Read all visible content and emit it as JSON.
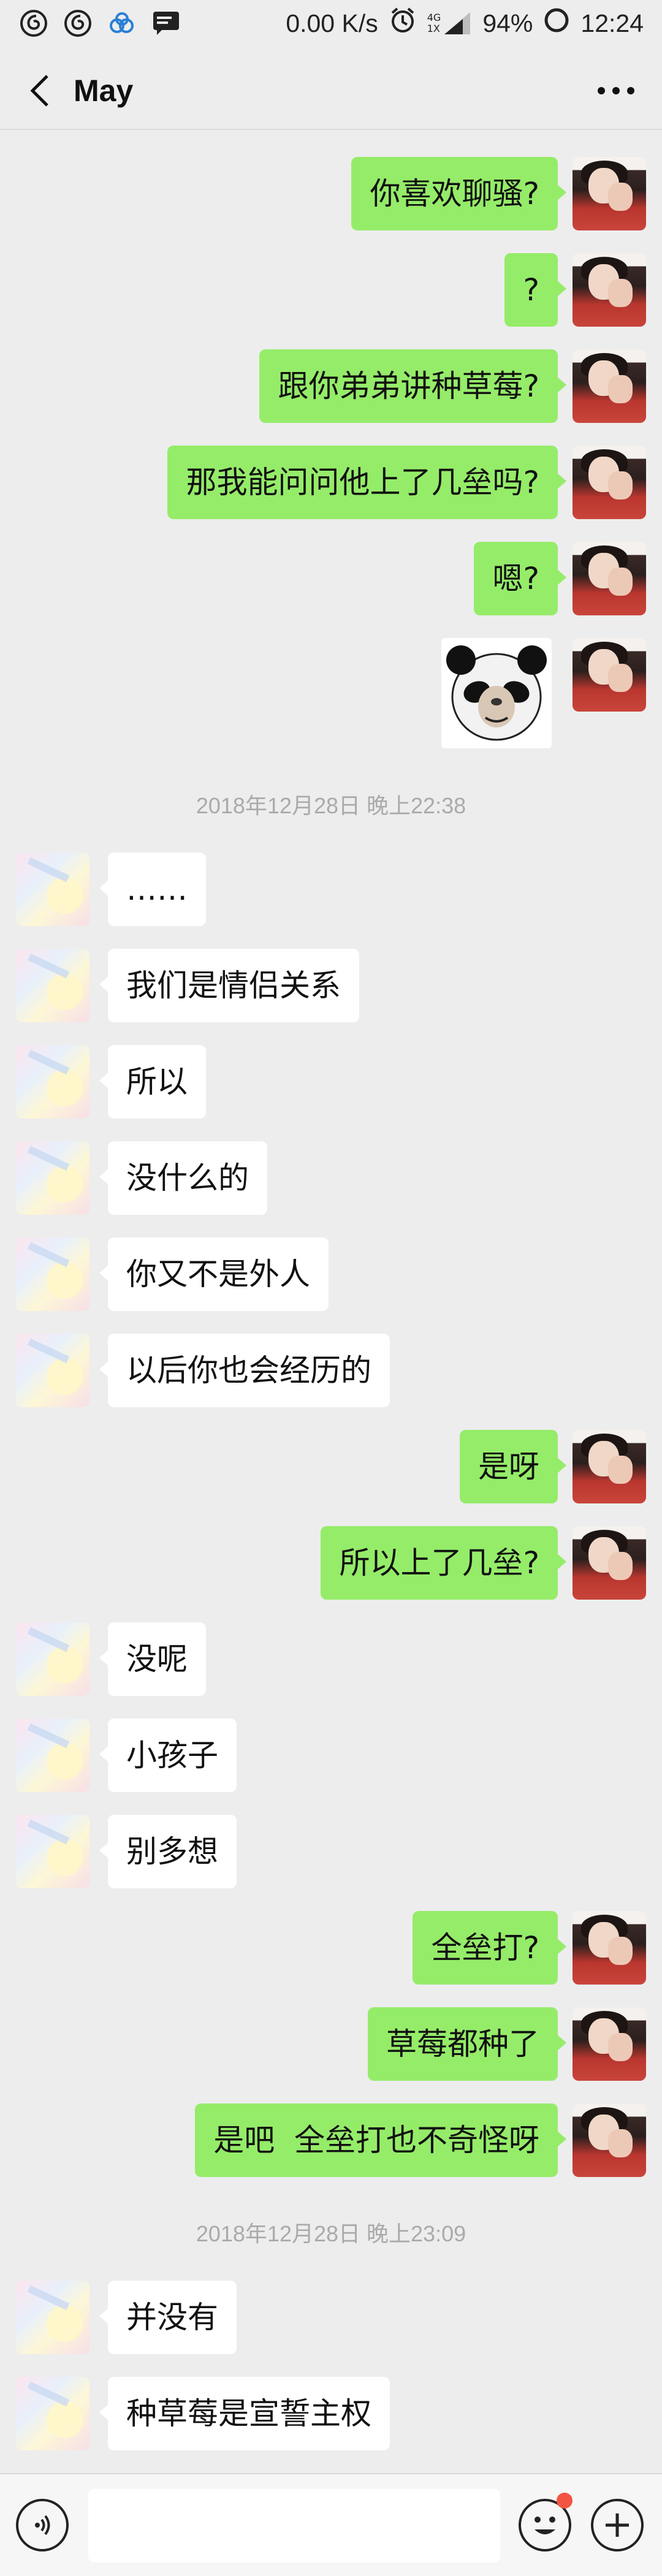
{
  "status_bar": {
    "net_speed": "0.00 K/s",
    "battery": "94%",
    "time": "12:24",
    "net_badge_top": "4G",
    "net_badge_bottom": "1X",
    "icons": [
      "netease-music-icon",
      "netease-music-icon",
      "cloud-icon",
      "message-icon",
      "alarm-icon",
      "signal-icon",
      "battery-icon"
    ]
  },
  "header": {
    "title": "May",
    "back_icon": "chevron-left-icon",
    "more_icon": "more-dots-icon"
  },
  "messages": [
    {
      "side": "right",
      "text": "你喜欢聊骚?"
    },
    {
      "side": "right",
      "text": "?"
    },
    {
      "side": "right",
      "text": "跟你弟弟讲种草莓?"
    },
    {
      "side": "right",
      "text": "那我能问问他上了几垒吗?"
    },
    {
      "side": "right",
      "text": "嗯?"
    },
    {
      "side": "right",
      "type": "sticker",
      "sticker": "panda-face-sticker"
    },
    {
      "type": "timestamp",
      "text": "2018年12月28日 晚上22:38"
    },
    {
      "side": "left",
      "text": "……"
    },
    {
      "side": "left",
      "text": "我们是情侣关系"
    },
    {
      "side": "left",
      "text": "所以"
    },
    {
      "side": "left",
      "text": "没什么的"
    },
    {
      "side": "left",
      "text": "你又不是外人"
    },
    {
      "side": "left",
      "text": "以后你也会经历的"
    },
    {
      "side": "right",
      "text": "是呀"
    },
    {
      "side": "right",
      "text": "所以上了几垒?"
    },
    {
      "side": "left",
      "text": "没呢"
    },
    {
      "side": "left",
      "text": "小孩子"
    },
    {
      "side": "left",
      "text": "别多想"
    },
    {
      "side": "right",
      "text": "全垒打?"
    },
    {
      "side": "right",
      "text": "草莓都种了"
    },
    {
      "side": "right",
      "text": "是吧  全垒打也不奇怪呀"
    },
    {
      "type": "timestamp",
      "text": "2018年12月28日 晚上23:09"
    },
    {
      "side": "left",
      "text": "并没有"
    },
    {
      "side": "left",
      "text": "种草莓是宣誓主权"
    }
  ],
  "input_bar": {
    "voice_icon": "voice-icon",
    "input_value": "",
    "emoji_icon": "emoji-icon",
    "plus_icon": "plus-icon"
  },
  "colors": {
    "background": "#ededed",
    "bubble_self": "#95ec69",
    "bubble_other": "#ffffff",
    "timestamp": "#aaaaaa",
    "badge": "#f25542"
  }
}
